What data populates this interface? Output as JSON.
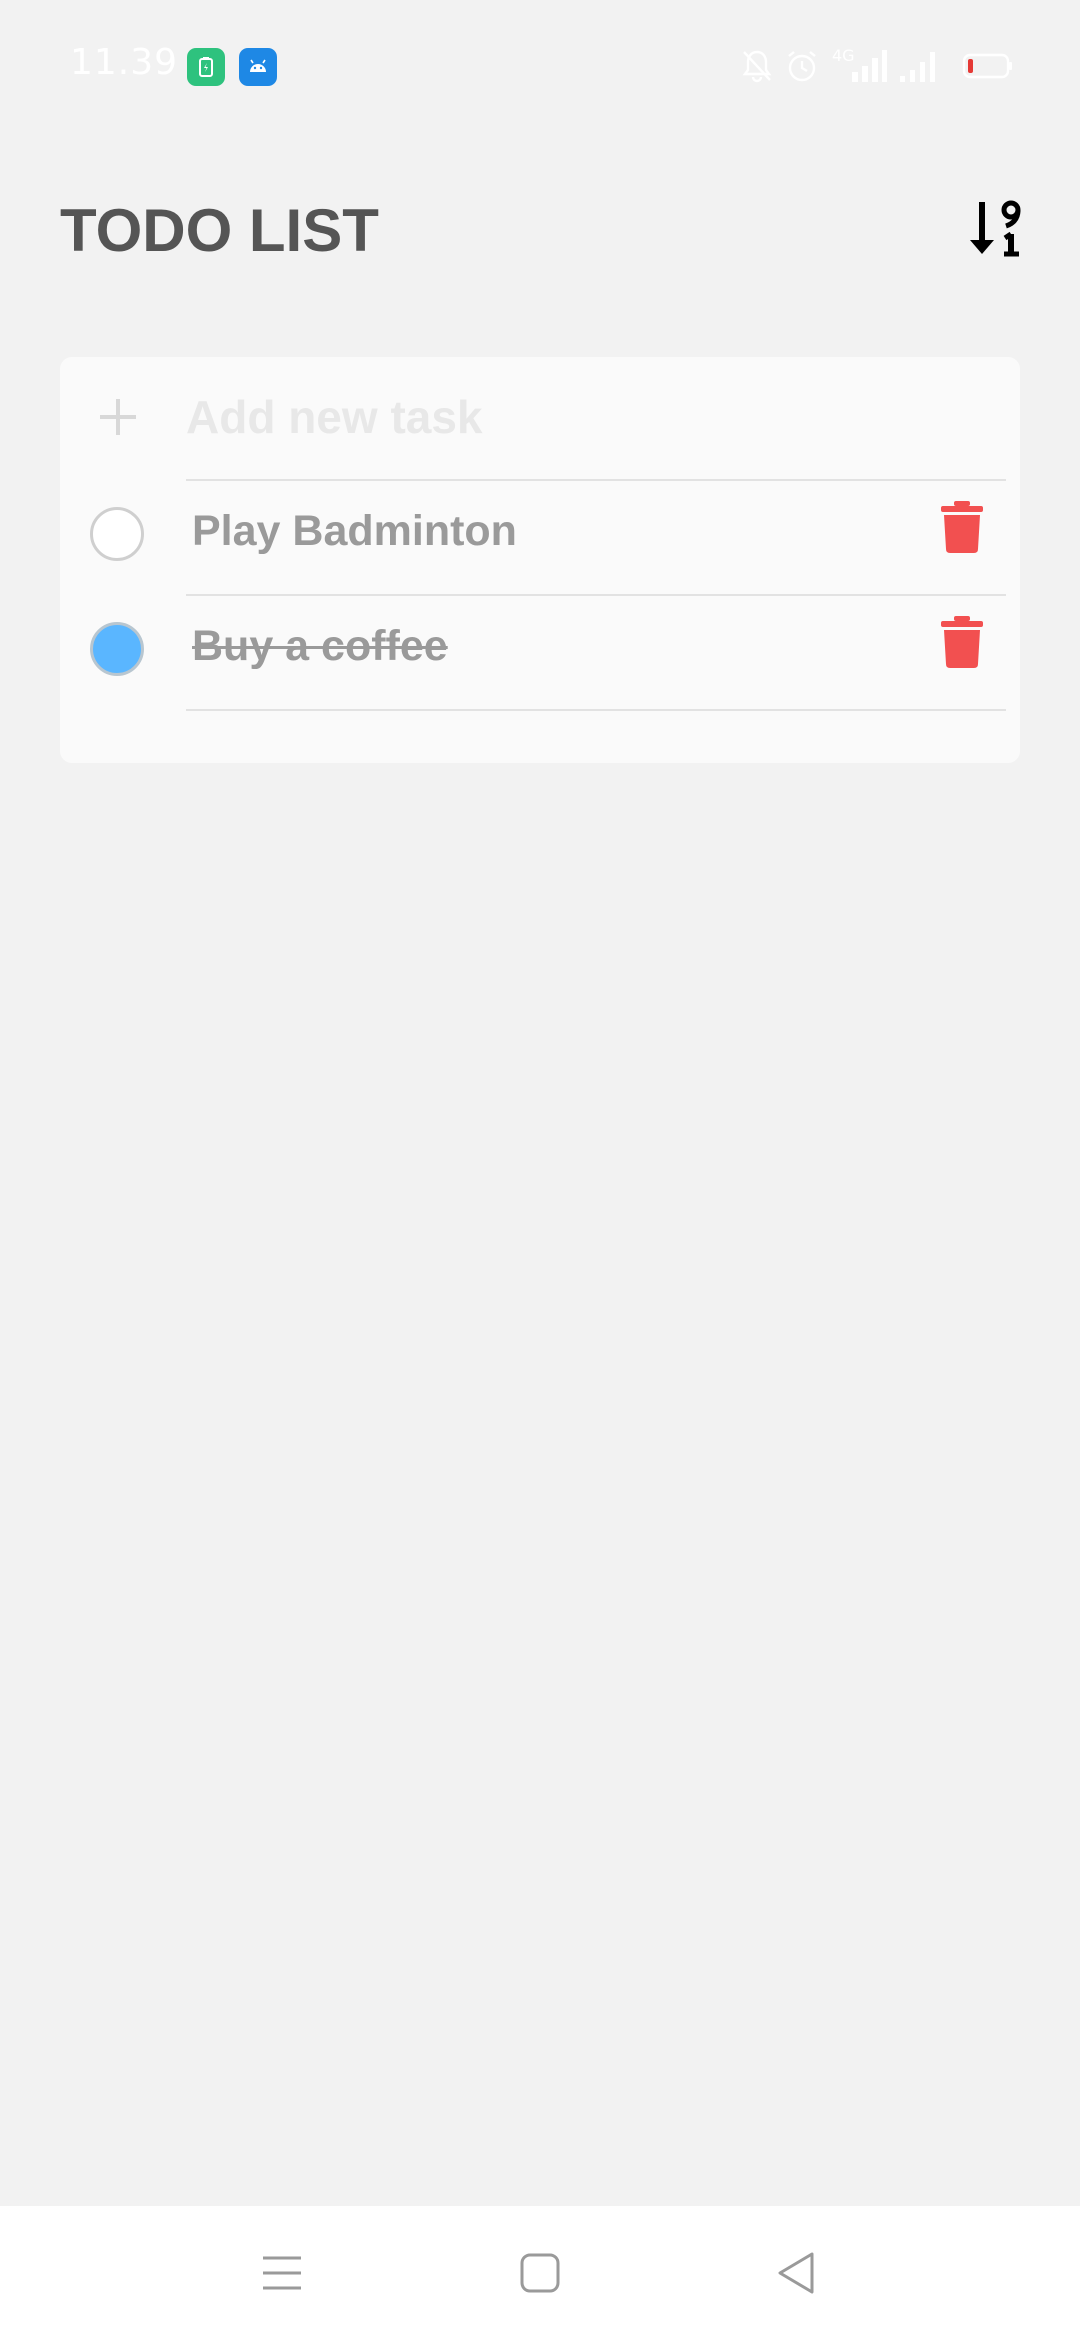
{
  "status_bar": {
    "time": "11.39",
    "network_label": "4G",
    "icons": [
      "battery-app-icon",
      "android-app-icon",
      "bell-off-icon",
      "alarm-icon",
      "signal-icon",
      "signal-icon",
      "battery-icon"
    ]
  },
  "header": {
    "title": "TODO LIST",
    "sort_icon": "sort-numeric-icon"
  },
  "new_task": {
    "placeholder": "Add new task",
    "value": ""
  },
  "tasks": [
    {
      "label": "Play Badminton",
      "completed": false
    },
    {
      "label": "Buy a coffee",
      "completed": true
    }
  ],
  "colors": {
    "background": "#f2f2f2",
    "card": "#fafafa",
    "title": "#555555",
    "task_text": "#9a9a9a",
    "checked": "#5ab6ff",
    "delete": "#f25050"
  },
  "nav_bar": {
    "icons": [
      "menu-icon",
      "home-icon",
      "back-icon"
    ]
  }
}
